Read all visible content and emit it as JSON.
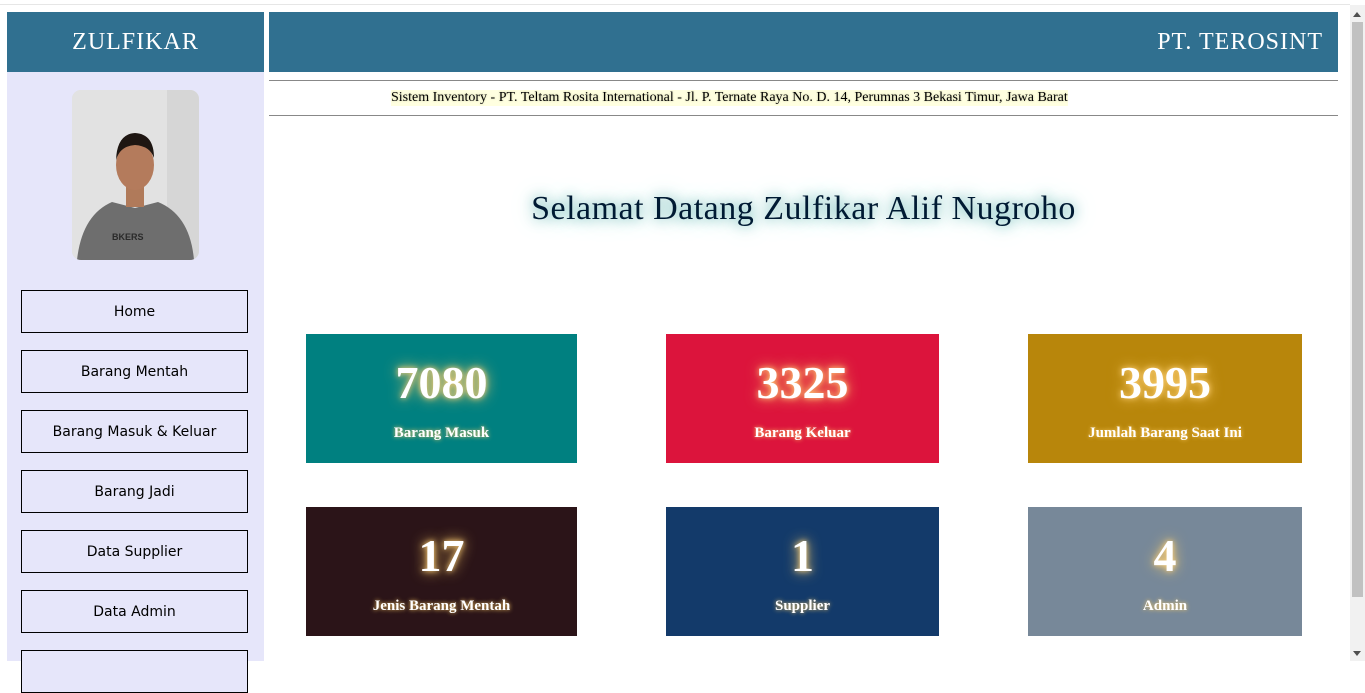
{
  "sidebar": {
    "user_name": "ZULFIKAR",
    "menu": [
      {
        "label": "Home"
      },
      {
        "label": "Barang Mentah"
      },
      {
        "label": "Barang Masuk & Keluar"
      },
      {
        "label": "Barang Jadi"
      },
      {
        "label": "Data Supplier"
      },
      {
        "label": "Data Admin"
      }
    ]
  },
  "header": {
    "company": "PT. TEROSINT",
    "marquee": "Sistem Inventory - PT. Teltam Rosita International - Jl. P. Ternate Raya No. D. 14, Perumnas 3 Bekasi Timur, Jawa Barat"
  },
  "welcome": "Selamat Datang Zulfikar Alif Nugroho",
  "stats": [
    {
      "value": "7080",
      "label": "Barang Masuk",
      "color": "#008080"
    },
    {
      "value": "3325",
      "label": "Barang Keluar",
      "color": "#dc143c"
    },
    {
      "value": "3995",
      "label": "Jumlah Barang Saat Ini",
      "color": "#b8860b"
    },
    {
      "value": "17",
      "label": "Jenis Barang Mentah",
      "color": "#2b1418"
    },
    {
      "value": "1",
      "label": "Supplier",
      "color": "#133a6a"
    },
    {
      "value": "4",
      "label": "Admin",
      "color": "#778899"
    }
  ]
}
